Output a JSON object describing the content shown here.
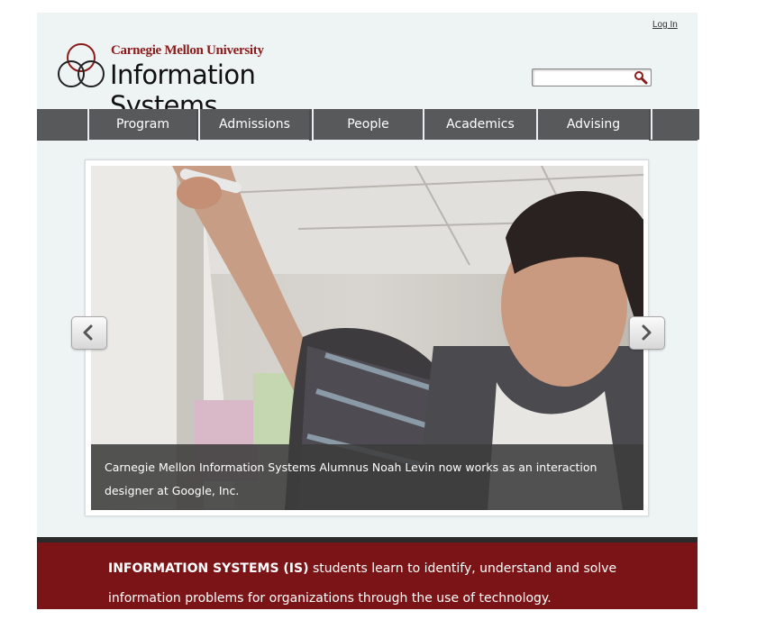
{
  "header": {
    "login_label": "Log In",
    "logo_university": "Carnegie Mellon University",
    "logo_program": "Information Systems",
    "search": {
      "placeholder": "",
      "value": ""
    }
  },
  "nav": {
    "items": [
      {
        "label": "Program"
      },
      {
        "label": "Admissions"
      },
      {
        "label": "People"
      },
      {
        "label": "Academics"
      },
      {
        "label": "Advising"
      }
    ]
  },
  "slider": {
    "caption": "Carnegie Mellon Information Systems Alumnus Noah Levin now works as an interaction designer at Google, Inc.",
    "prev_icon": "chevron-left-icon",
    "next_icon": "chevron-right-icon"
  },
  "banner": {
    "lead": "INFORMATION SYSTEMS (IS)",
    "text": " students learn to identify, understand and solve information problems for organizations through the use of technology."
  },
  "colors": {
    "brand_red": "#8a1c1c",
    "banner_red": "#7a1416",
    "nav_gray": "#58595b",
    "page_bg": "#eef3f4"
  }
}
